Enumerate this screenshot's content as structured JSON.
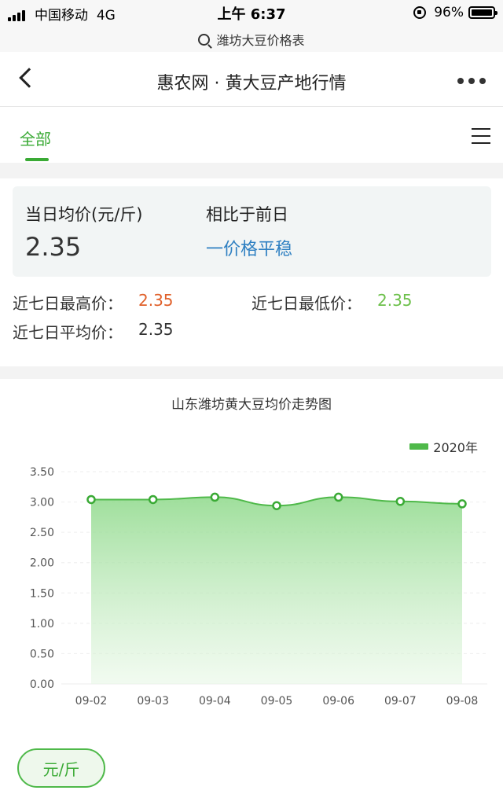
{
  "status_bar": {
    "carrier": "中国移动",
    "network": "4G",
    "time": "上午 6:37",
    "battery": "96%"
  },
  "search": {
    "query": "潍坊大豆价格表"
  },
  "nav": {
    "title": "惠农网 · 黄大豆产地行情"
  },
  "tabs": [
    {
      "label": "全部",
      "active": true
    }
  ],
  "summary": {
    "avg_label": "当日均价(元/斤)",
    "avg_value": "2.35",
    "compare_label": "相比于前日",
    "compare_value": "一价格平稳"
  },
  "stats": {
    "high_label": "近七日最高价：",
    "high_value": "2.35",
    "low_label": "近七日最低价：",
    "low_value": "2.35",
    "avg_label": "近七日平均价：",
    "avg_value": "2.35"
  },
  "unit_button": "元/斤",
  "colors": {
    "accent": "#3aaa35",
    "high": "#e0602a",
    "low": "#6cc04a",
    "trend": "#2f80c2"
  },
  "chart_data": {
    "type": "area",
    "title": "山东潍坊黄大豆均价走势图",
    "categories": [
      "09-02",
      "09-03",
      "09-04",
      "09-05",
      "09-06",
      "09-07",
      "09-08"
    ],
    "series": [
      {
        "name": "2020年",
        "values": [
          3.04,
          3.04,
          3.08,
          2.94,
          3.08,
          3.01,
          2.97
        ]
      }
    ],
    "y_ticks": [
      "3.50",
      "3.00",
      "2.50",
      "2.00",
      "1.50",
      "1.00",
      "0.50",
      "0.00"
    ],
    "ylim": [
      0,
      3.5
    ],
    "legend": "top-right",
    "grid": true
  }
}
